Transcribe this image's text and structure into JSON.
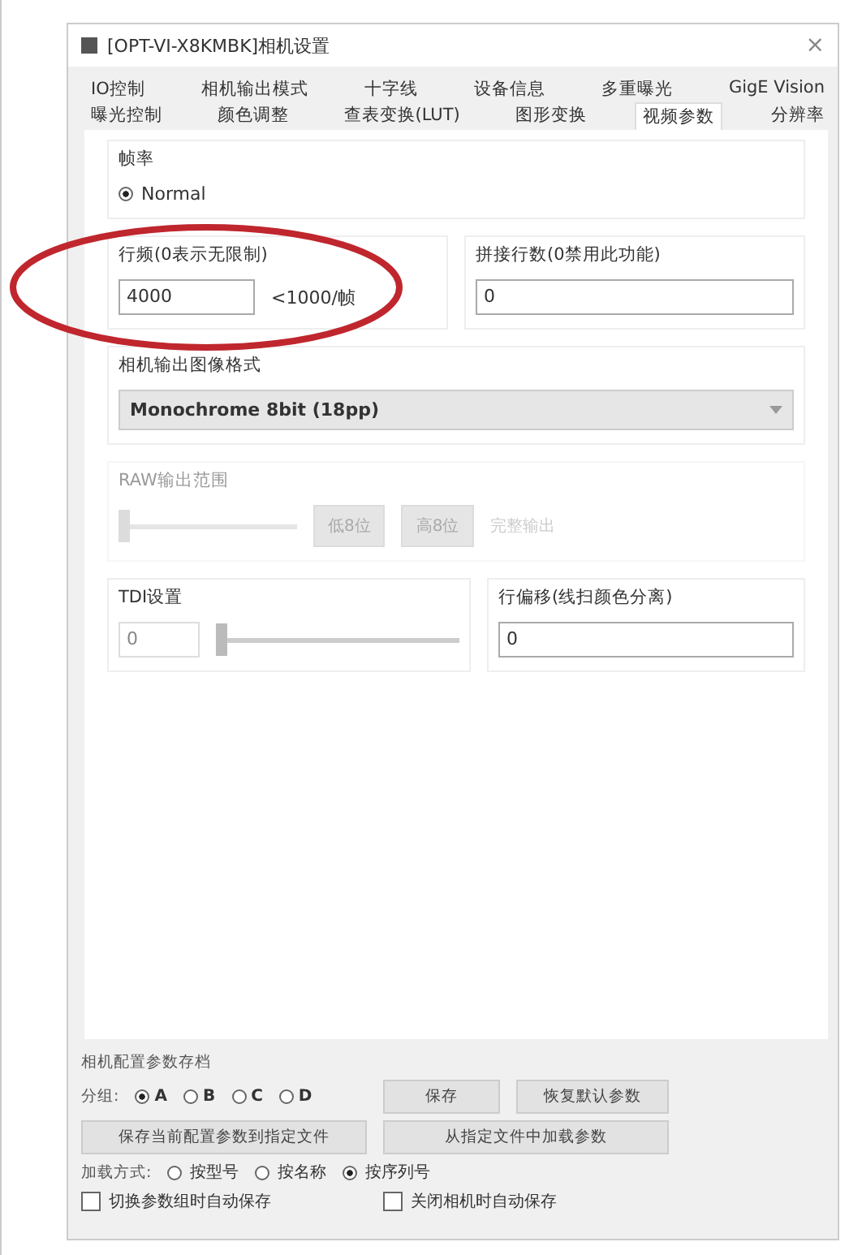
{
  "window": {
    "title": "[OPT-VI-X8KMBK]相机设置",
    "close": "×"
  },
  "tab_rows": [
    [
      {
        "label": "IO控制",
        "selected": false
      },
      {
        "label": "相机输出模式",
        "selected": false
      },
      {
        "label": "十字线",
        "selected": false
      },
      {
        "label": "设备信息",
        "selected": false
      },
      {
        "label": "多重曝光",
        "selected": false
      },
      {
        "label": "GigE Vision",
        "selected": false
      }
    ],
    [
      {
        "label": "曝光控制",
        "selected": false
      },
      {
        "label": "颜色调整",
        "selected": false
      },
      {
        "label": "查表变换(LUT)",
        "selected": false
      },
      {
        "label": "图形变换",
        "selected": false
      },
      {
        "label": "视频参数",
        "selected": true
      },
      {
        "label": "分辨率",
        "selected": false
      }
    ]
  ],
  "frame_rate": {
    "title": "帧率",
    "option": {
      "label": "Normal",
      "selected": true
    }
  },
  "line_rate": {
    "title": "行频(0表示无限制)",
    "value": "4000",
    "hint": "<1000/帧"
  },
  "stitch_lines": {
    "title": "拼接行数(0禁用此功能)",
    "value": "0"
  },
  "output_format": {
    "title": "相机输出图像格式",
    "value": "Monochrome 8bit (18pp)"
  },
  "raw_range": {
    "title": "RAW输出范围",
    "disabled": true,
    "level": 0,
    "buttons": [
      "低8位",
      "高8位"
    ],
    "label": "完整输出"
  },
  "tdi": {
    "title": "TDI设置",
    "placeholder": "0",
    "level": 0
  },
  "line_offset": {
    "title": "行偏移(线扫颜色分离)",
    "value": "0"
  },
  "annotation": {
    "kind": "ellipse",
    "color": "#c0262d"
  },
  "archive": {
    "title": "相机配置参数存档",
    "group_label": "分组:",
    "groups": [
      {
        "label": "A",
        "selected": true
      },
      {
        "label": "B",
        "selected": false
      },
      {
        "label": "C",
        "selected": false
      },
      {
        "label": "D",
        "selected": false
      }
    ],
    "buttons": [
      "保存",
      "恢复默认参数",
      "保存当前配置参数到指定文件",
      "从指定文件中加载参数"
    ],
    "load_label": "加载方式:",
    "load_modes": [
      {
        "label": "按型号",
        "selected": false
      },
      {
        "label": "按名称",
        "selected": false
      },
      {
        "label": "按序列号",
        "selected": true
      }
    ],
    "checks": [
      {
        "label": "切换参数组时自动保存",
        "checked": false
      },
      {
        "label": "关闭相机时自动保存",
        "checked": false
      }
    ]
  }
}
